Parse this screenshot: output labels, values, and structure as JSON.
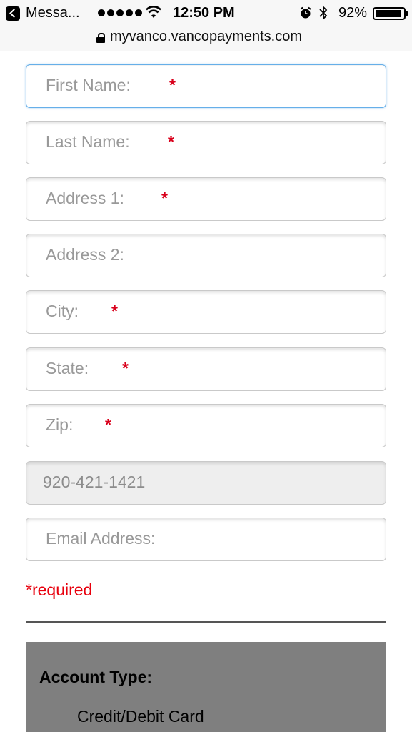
{
  "status_bar": {
    "back_app": "Messa...",
    "time": "12:50 PM",
    "battery_percent": "92%",
    "signal_dots": 5,
    "battery_level": 0.92
  },
  "url_bar": {
    "url": "myvanco.vancopayments.com"
  },
  "form": {
    "first_name": {
      "placeholder": "First Name:",
      "required_mark": "*"
    },
    "last_name": {
      "placeholder": "Last Name:",
      "required_mark": "*"
    },
    "address1": {
      "placeholder": "Address 1:",
      "required_mark": "*"
    },
    "address2": {
      "placeholder": "Address 2:"
    },
    "city": {
      "placeholder": "City:",
      "required_mark": "*"
    },
    "state": {
      "placeholder": "State:",
      "required_mark": "*"
    },
    "zip": {
      "placeholder": "Zip:",
      "required_mark": "*"
    },
    "phone": {
      "value": "920-421-1421"
    },
    "email": {
      "placeholder": "Email Address:"
    },
    "required_note": "*required"
  },
  "account": {
    "title": "Account Type:",
    "option": "Credit/Debit Card"
  },
  "colors": {
    "required_red": "#e8000d",
    "focus_blue": "#66afe9",
    "account_bg": "#7f7f7f"
  }
}
